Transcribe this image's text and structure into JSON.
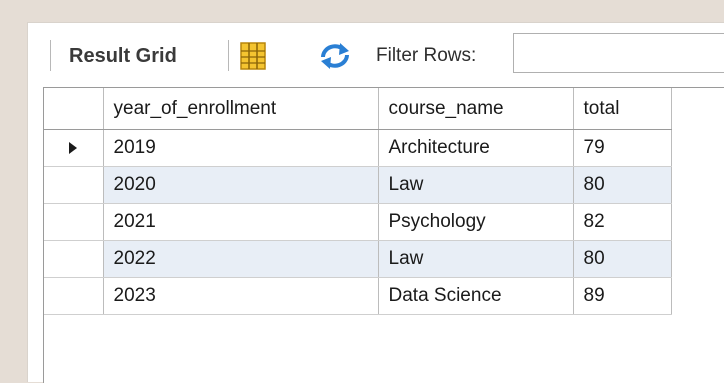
{
  "toolbar": {
    "result_grid_label": "Result Grid",
    "filter_label": "Filter Rows:",
    "filter_value": ""
  },
  "grid": {
    "columns": [
      "year_of_enrollment",
      "course_name",
      "total"
    ],
    "rows": [
      {
        "year_of_enrollment": "2019",
        "course_name": "Architecture",
        "total": "79"
      },
      {
        "year_of_enrollment": "2020",
        "course_name": "Law",
        "total": "80"
      },
      {
        "year_of_enrollment": "2021",
        "course_name": "Psychology",
        "total": "82"
      },
      {
        "year_of_enrollment": "2022",
        "course_name": "Law",
        "total": "80"
      },
      {
        "year_of_enrollment": "2023",
        "course_name": "Data Science",
        "total": "89"
      }
    ],
    "current_row_index": 0
  },
  "colors": {
    "alternate_row": "#e8eef6",
    "grid_icon": "#e8b82a",
    "refresh_icon": "#2a7fd4"
  }
}
